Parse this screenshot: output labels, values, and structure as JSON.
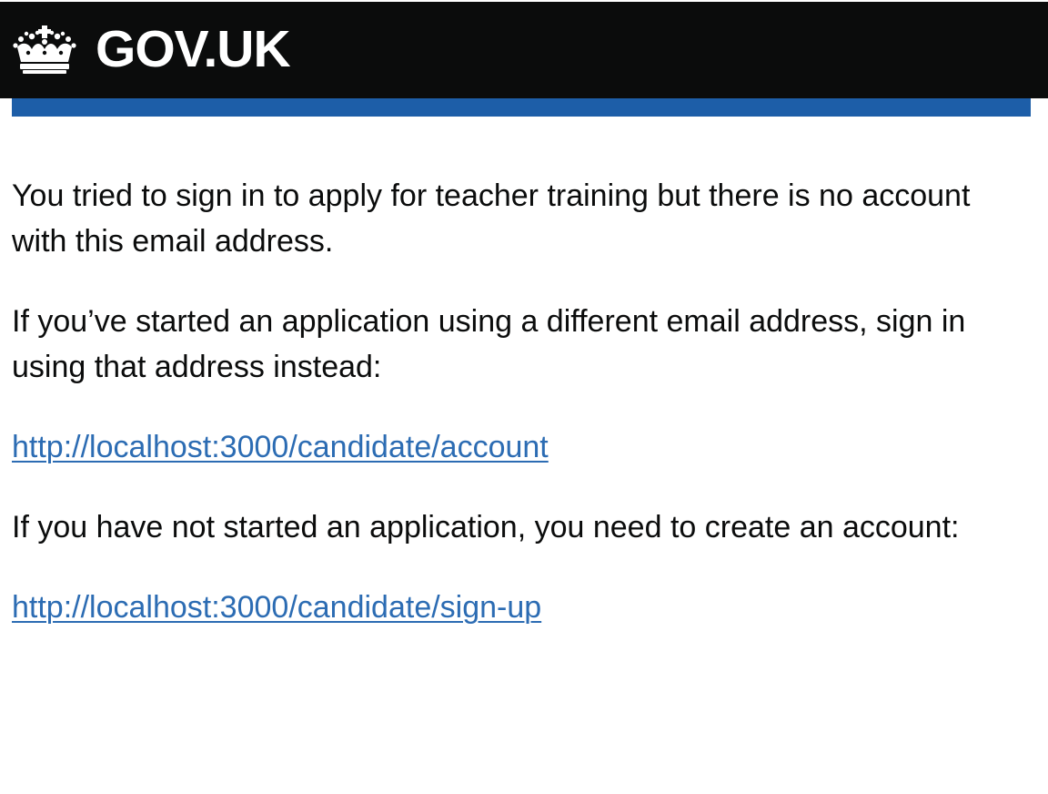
{
  "header": {
    "logo_icon": "crown-icon",
    "logotype": "GOV.UK"
  },
  "colors": {
    "header_background": "#0b0c0c",
    "accent_bar": "#1d5ea8",
    "link": "#2c6cb3",
    "text": "#0b0c0c"
  },
  "email": {
    "paragraph_1": "You tried to sign in to apply for teacher training but there is no account with this email address.",
    "paragraph_2": "If you’ve started an application using a different email address, sign in using that address instead:",
    "account_link": "http://localhost:3000/candidate/account",
    "paragraph_3": "If you have not started an application, you need to create an account:",
    "signup_link": "http://localhost:3000/candidate/sign-up"
  }
}
